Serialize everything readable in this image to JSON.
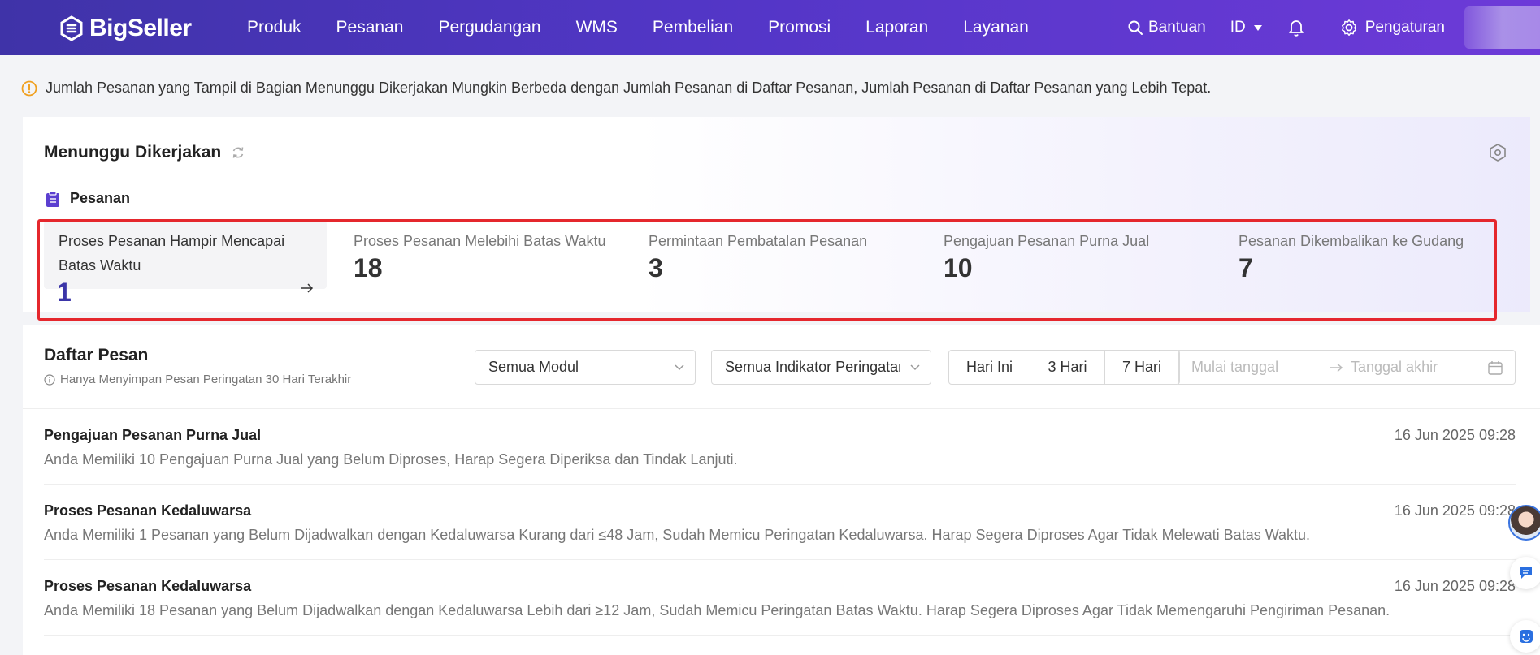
{
  "brand": {
    "name": "BigSeller"
  },
  "nav": {
    "items": [
      "Produk",
      "Pesanan",
      "Pergudangan",
      "WMS",
      "Pembelian",
      "Promosi",
      "Laporan",
      "Layanan"
    ],
    "help_label": "Bantuan",
    "lang_label": "ID",
    "settings_label": "Pengaturan"
  },
  "notice": {
    "text": "Jumlah Pesanan yang Tampil di Bagian Menunggu Dikerjakan Mungkin Berbeda dengan Jumlah Pesanan di Daftar Pesanan, Jumlah Pesanan di Daftar Pesanan yang Lebih Tepat."
  },
  "pending": {
    "title": "Menunggu Dikerjakan",
    "section_label": "Pesanan",
    "metrics": [
      {
        "label": "Proses Pesanan Hampir Mencapai Batas Waktu",
        "value": "1"
      },
      {
        "label": "Proses Pesanan Melebihi Batas Waktu",
        "value": "18"
      },
      {
        "label": "Permintaan Pembatalan Pesanan",
        "value": "3"
      },
      {
        "label": "Pengajuan Pesanan Purna Jual",
        "value": "10"
      },
      {
        "label": "Pesanan Dikembalikan ke Gudang",
        "value": "7"
      }
    ]
  },
  "list": {
    "title": "Daftar Pesan",
    "subtitle": "Hanya Menyimpan Pesan Peringatan 30 Hari Terakhir",
    "module_select": "Semua Modul",
    "indicator_select": "Semua Indikator Peringatan",
    "ranges": [
      "Hari Ini",
      "3 Hari",
      "7 Hari"
    ],
    "date_start_placeholder": "Mulai tanggal",
    "date_end_placeholder": "Tanggal akhir",
    "messages": [
      {
        "title": "Pengajuan Pesanan Purna Jual",
        "time": "16 Jun 2025 09:28",
        "desc": "Anda Memiliki 10 Pengajuan Purna Jual yang Belum Diproses, Harap Segera Diperiksa dan Tindak Lanjuti."
      },
      {
        "title": "Proses Pesanan Kedaluwarsa",
        "time": "16 Jun 2025 09:28",
        "desc": "Anda Memiliki 1 Pesanan yang Belum Dijadwalkan dengan Kedaluwarsa Kurang dari ≤48 Jam, Sudah Memicu Peringatan Kedaluwarsa. Harap Segera Diproses Agar Tidak Melewati Batas Waktu."
      },
      {
        "title": "Proses Pesanan Kedaluwarsa",
        "time": "16 Jun 2025 09:28",
        "desc": "Anda Memiliki 18 Pesanan yang Belum Dijadwalkan dengan Kedaluwarsa Lebih dari ≥12 Jam, Sudah Memicu Peringatan Batas Waktu. Harap Segera Diproses Agar Tidak Memengaruhi Pengiriman Pesanan."
      }
    ]
  },
  "colors": {
    "accent": "#4f35c2",
    "highlight": "#e5272d",
    "value_active": "#3b35a8"
  }
}
